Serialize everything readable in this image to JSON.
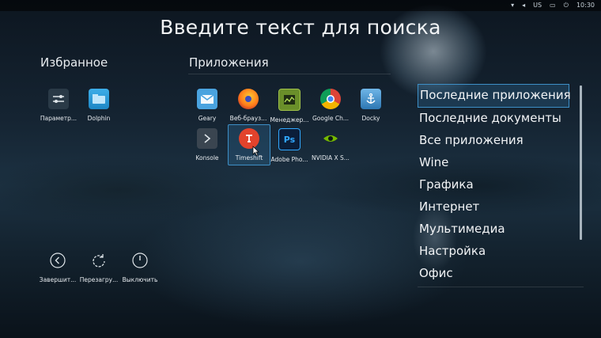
{
  "search_title": "Введите текст для поиска",
  "favorites": {
    "title": "Избранное",
    "items": [
      {
        "label": "Параметр...",
        "icon": "settings-sliders-icon"
      },
      {
        "label": "Dolphin",
        "icon": "folder-icon"
      }
    ]
  },
  "apps": {
    "title": "Приложения",
    "items": [
      {
        "label": "Geary",
        "icon": "geary-mail-icon"
      },
      {
        "label": "Веб-брауз...",
        "icon": "firefox-icon"
      },
      {
        "label": "Менеджер...",
        "icon": "task-manager-icon"
      },
      {
        "label": "Google Ch...",
        "icon": "chrome-icon"
      },
      {
        "label": "Docky",
        "icon": "anchor-icon"
      },
      {
        "label": "Konsole",
        "icon": "terminal-icon"
      },
      {
        "label": "Timeshift",
        "icon": "timeshift-icon",
        "selected": true
      },
      {
        "label": "Adobe Pho...",
        "icon": "photoshop-icon"
      },
      {
        "label": "NVIDIA X S...",
        "icon": "nvidia-icon"
      }
    ]
  },
  "categories": [
    {
      "label": "Последние приложения",
      "selected": true
    },
    {
      "label": "Последние документы"
    },
    {
      "label": "Все приложения"
    },
    {
      "label": "Wine"
    },
    {
      "label": "Графика"
    },
    {
      "label": "Интернет"
    },
    {
      "label": "Мультимедиа"
    },
    {
      "label": "Настройка"
    },
    {
      "label": "Офис"
    }
  ],
  "power": [
    {
      "label": "Завершит...",
      "icon": "logout-icon"
    },
    {
      "label": "Перезагру...",
      "icon": "restart-icon"
    },
    {
      "label": "Выключить",
      "icon": "power-icon"
    }
  ],
  "tray": {
    "lang": "US",
    "clock": "10:30"
  },
  "colors": {
    "accent": "#3d8fc7"
  }
}
